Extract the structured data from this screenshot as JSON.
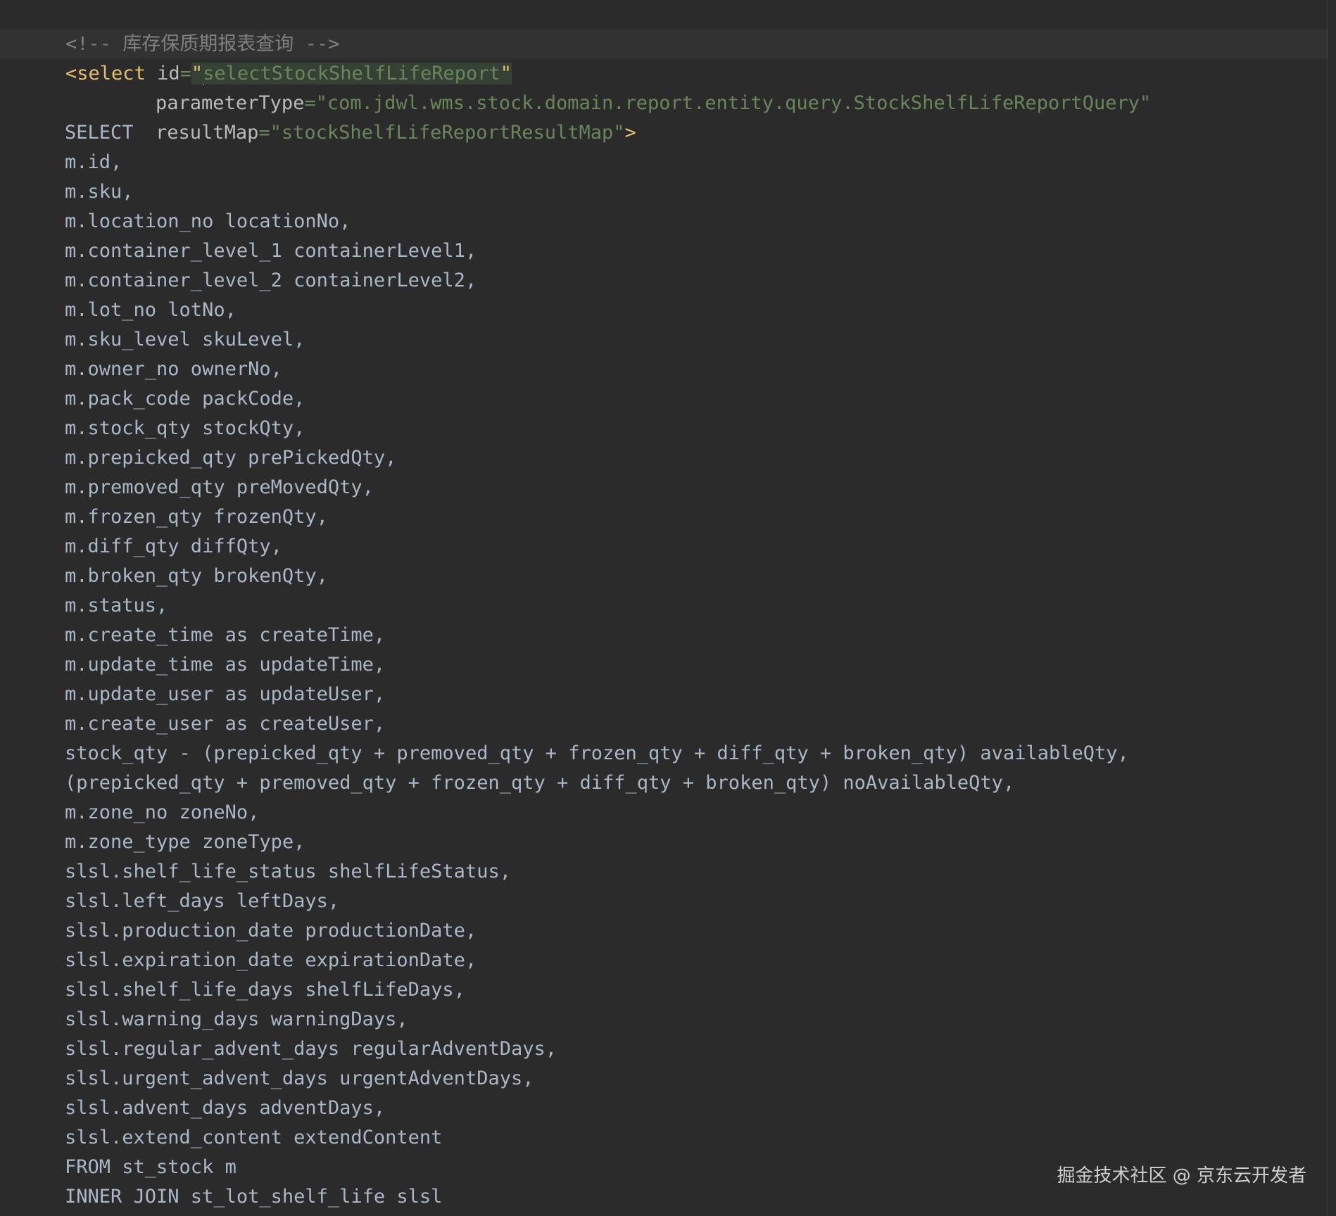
{
  "comment_line": "<!-- 库存保质期报表查询 -->",
  "select_tag": {
    "open": "<select",
    "id_attr": "id",
    "eq": "=",
    "quote": "\"",
    "id_value": "selectStockShelfLifeReport",
    "param_attr": "parameterType",
    "param_value": "\"com.jdwl.wms.stock.domain.report.entity.query.StockShelfLifeReportQuery\"",
    "result_attr": "resultMap",
    "result_value": "\"stockShelfLifeReportResultMap\"",
    "close": ">"
  },
  "sql_lines": [
    "SELECT",
    "m.id,",
    "m.sku,",
    "m.location_no locationNo,",
    "m.container_level_1 containerLevel1,",
    "m.container_level_2 containerLevel2,",
    "m.lot_no lotNo,",
    "m.sku_level skuLevel,",
    "m.owner_no ownerNo,",
    "m.pack_code packCode,",
    "m.stock_qty stockQty,",
    "m.prepicked_qty prePickedQty,",
    "m.premoved_qty preMovedQty,",
    "m.frozen_qty frozenQty,",
    "m.diff_qty diffQty,",
    "m.broken_qty brokenQty,",
    "m.status,",
    "m.create_time as createTime,",
    "m.update_time as updateTime,",
    "m.update_user as updateUser,",
    "m.create_user as createUser,",
    "stock_qty - (prepicked_qty + premoved_qty + frozen_qty + diff_qty + broken_qty) availableQty,",
    "(prepicked_qty + premoved_qty + frozen_qty + diff_qty + broken_qty) noAvailableQty,",
    "m.zone_no zoneNo,",
    "m.zone_type zoneType,",
    "slsl.shelf_life_status shelfLifeStatus,",
    "slsl.left_days leftDays,",
    "slsl.production_date productionDate,",
    "slsl.expiration_date expirationDate,",
    "slsl.shelf_life_days shelfLifeDays,",
    "slsl.warning_days warningDays,",
    "slsl.regular_advent_days regularAdventDays,",
    "slsl.urgent_advent_days urgentAdventDays,",
    "slsl.advent_days adventDays,",
    "slsl.extend_content extendContent",
    "FROM st_stock m",
    "INNER JOIN st_lot_shelf_life slsl"
  ],
  "watermark": "掘金技术社区 @ 京东云开发者",
  "colors": {
    "background": "#2b2b2b",
    "comment": "#808080",
    "tag": "#e8bf6a",
    "attribute": "#bababa",
    "string": "#6a8759",
    "text": "#a9b7c6"
  }
}
